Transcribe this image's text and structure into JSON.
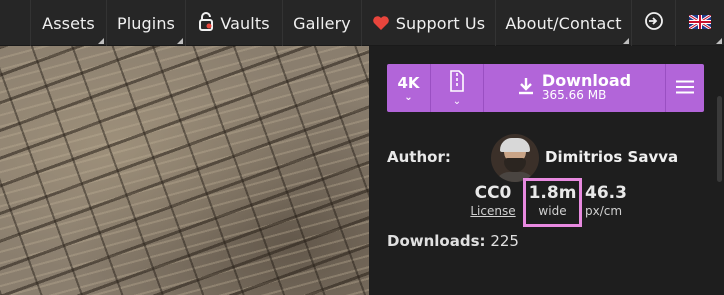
{
  "nav": {
    "assets": "Assets",
    "plugins": "Plugins",
    "vaults": "Vaults",
    "gallery": "Gallery",
    "support": "Support Us",
    "about": "About/Contact"
  },
  "download_bar": {
    "resolution": "4K",
    "download_label": "Download",
    "file_size": "365.66 MB"
  },
  "author": {
    "label": "Author:",
    "name": "Dimitrios Savva"
  },
  "stats": {
    "license_value": "CC0",
    "license_label": "License",
    "width_value": "1.8m",
    "width_label": "wide",
    "density_value": "46.3",
    "density_label": "px/cm"
  },
  "downloads": {
    "label": "Downloads:",
    "count": "225"
  },
  "colors": {
    "accent": "#b265d9",
    "highlight": "#e88ae0",
    "nav_bg": "#262626",
    "panel_bg": "#1e1e1e"
  },
  "icons": {
    "vaults": "lock-icon",
    "support": "heart-icon",
    "login": "login-icon",
    "language": "uk-flag-icon",
    "zip": "zip-file-icon",
    "download": "download-icon",
    "menu": "hamburger-menu-icon"
  }
}
